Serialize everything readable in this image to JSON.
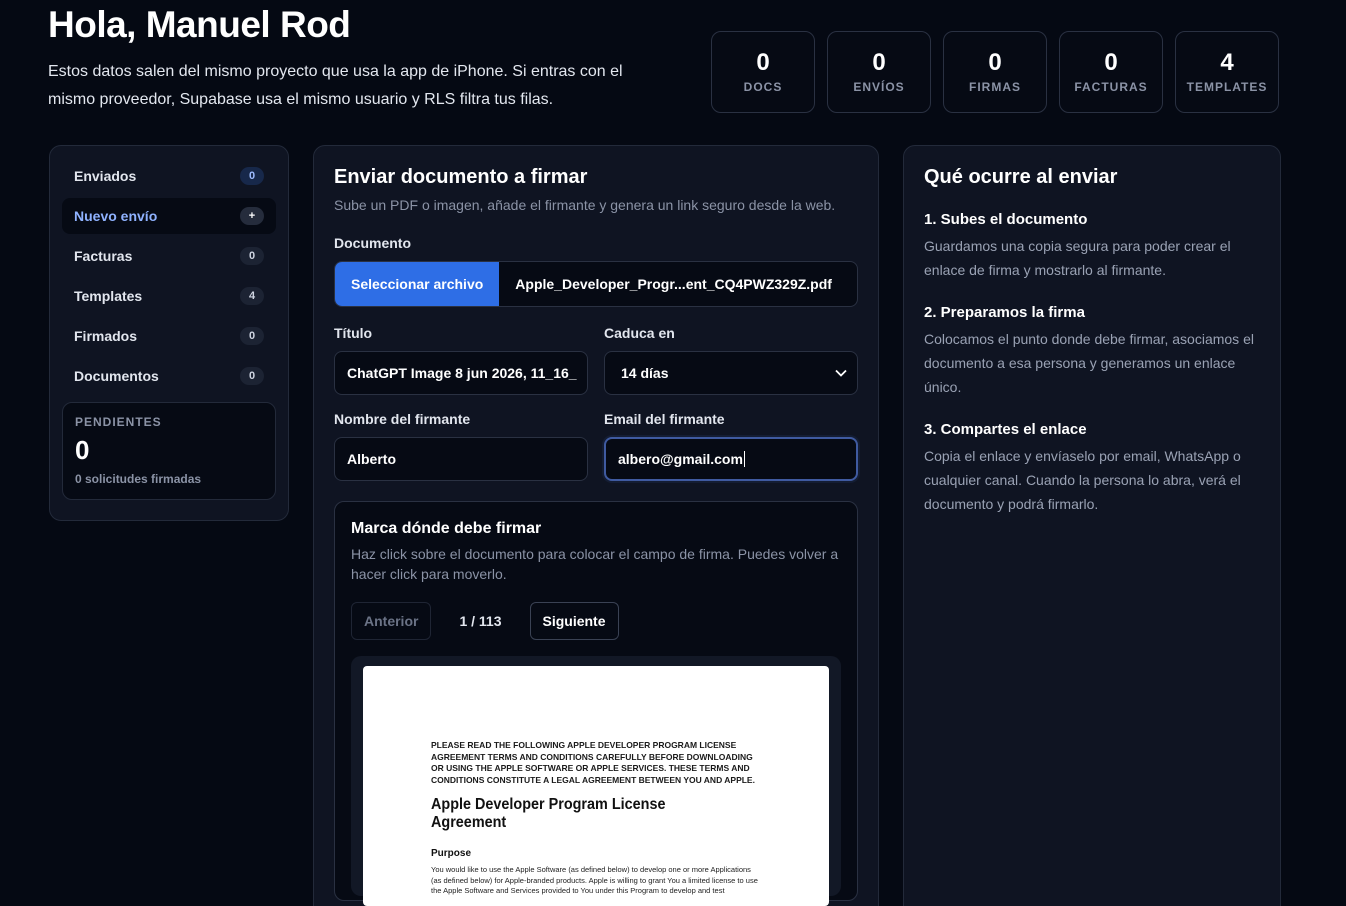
{
  "header": {
    "greeting": "Hola, Manuel Rod",
    "subtitle": "Estos datos salen del mismo proyecto que usa la app de iPhone. Si entras con el mismo proveedor, Supabase usa el mismo usuario y RLS filtra tus filas."
  },
  "stats": [
    {
      "value": "0",
      "label": "DOCS"
    },
    {
      "value": "0",
      "label": "ENVÍOS"
    },
    {
      "value": "0",
      "label": "FIRMAS"
    },
    {
      "value": "0",
      "label": "FACTURAS"
    },
    {
      "value": "4",
      "label": "TEMPLATES"
    }
  ],
  "sidebar": {
    "items": [
      {
        "label": "Enviados",
        "badge": "0"
      },
      {
        "label": "Nuevo envío",
        "badge": "+"
      },
      {
        "label": "Facturas",
        "badge": "0"
      },
      {
        "label": "Templates",
        "badge": "4"
      },
      {
        "label": "Firmados",
        "badge": "0"
      },
      {
        "label": "Documentos",
        "badge": "0"
      }
    ],
    "pending": {
      "title": "PENDIENTES",
      "value": "0",
      "subtitle": "0 solicitudes firmadas"
    }
  },
  "form": {
    "title": "Enviar documento a firmar",
    "description": "Sube un PDF o imagen, añade el firmante y genera un link seguro desde la web.",
    "document_label": "Documento",
    "file_button": "Seleccionar archivo",
    "file_name": "Apple_Developer_Progr...ent_CQ4PWZ329Z.pdf",
    "title_label": "Título",
    "title_value": "ChatGPT Image 8 jun 2026, 11_16_",
    "expires_label": "Caduca en",
    "expires_value": "14 días",
    "signer_name_label": "Nombre del firmante",
    "signer_name_value": "Alberto",
    "signer_email_label": "Email del firmante",
    "signer_email_value": "albero@gmail.com"
  },
  "mark": {
    "title": "Marca dónde debe firmar",
    "description": "Haz click sobre el documento para colocar el campo de firma. Puedes volver a hacer click para moverlo.",
    "prev": "Anterior",
    "page_info": "1 / 113",
    "next": "Siguiente"
  },
  "document_preview": {
    "notice": "PLEASE READ THE FOLLOWING APPLE DEVELOPER PROGRAM LICENSE AGREEMENT TERMS AND CONDITIONS CAREFULLY BEFORE DOWNLOADING OR USING THE APPLE SOFTWARE OR APPLE SERVICES.  THESE TERMS AND CONDITIONS CONSTITUTE A LEGAL AGREEMENT BETWEEN YOU AND APPLE.",
    "heading": "Apple Developer Program License Agreement",
    "section": "Purpose",
    "body": "You would like to use the Apple Software (as defined below) to develop one or more Applications (as defined below) for Apple-branded products.  Apple is willing to grant You a limited license to use the Apple Software and Services provided to You under this Program to develop and test"
  },
  "info": {
    "title": "Qué ocurre al enviar",
    "steps": [
      {
        "title": "1. Subes el documento",
        "text": "Guardamos una copia segura para poder crear el enlace de firma y mostrarlo al firmante."
      },
      {
        "title": "2. Preparamos la firma",
        "text": "Colocamos el punto donde debe firmar, asociamos el documento a esa persona y generamos un enlace único."
      },
      {
        "title": "3. Compartes el enlace",
        "text": "Copia el enlace y envíaselo por email, WhatsApp o cualquier canal. Cuando la persona lo abra, verá el documento y podrá firmarlo."
      }
    ]
  }
}
